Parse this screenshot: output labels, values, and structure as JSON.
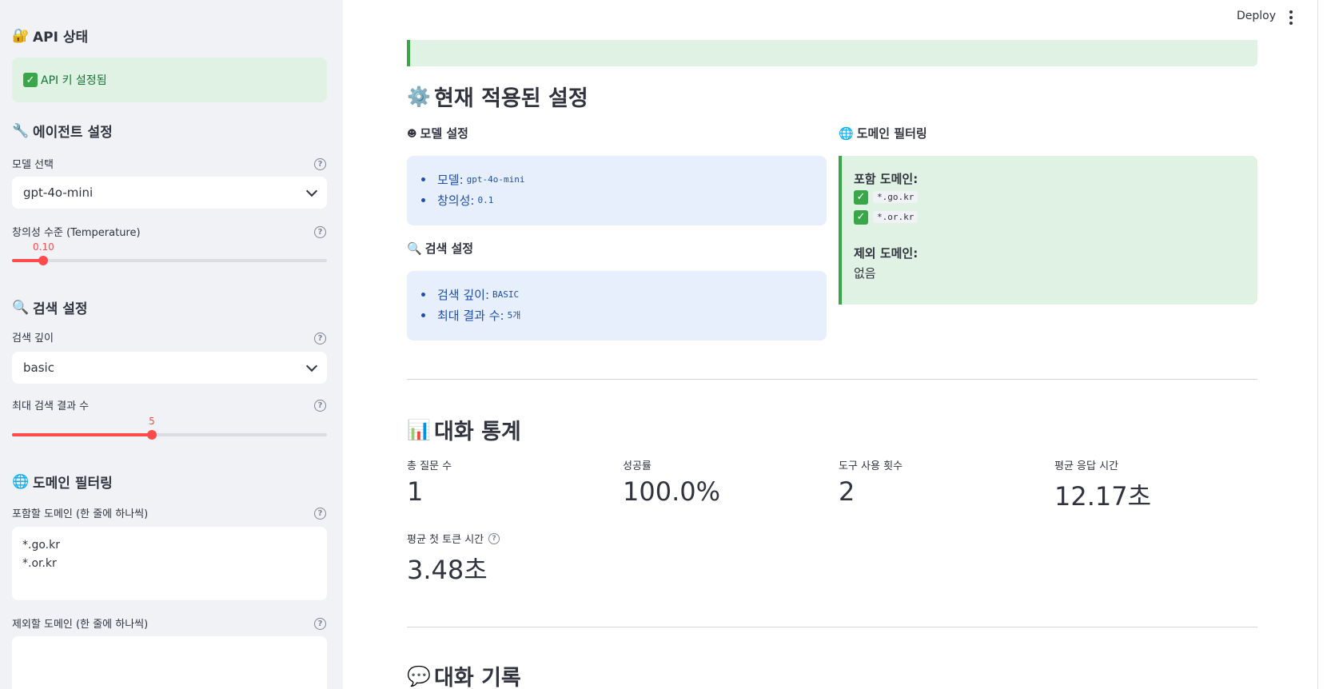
{
  "sidebar": {
    "api_status_title": "API 상태",
    "api_status_message": "API 키 설정됨",
    "agent_settings_title": "에이전트 설정",
    "model_label": "모델 선택",
    "model_value": "gpt-4o-mini",
    "temperature_label": "창의성 수준 (Temperature)",
    "temperature_value": "0.10",
    "temperature_fraction": 0.1,
    "search_settings_title": "검색 설정",
    "search_depth_label": "검색 깊이",
    "search_depth_value": "basic",
    "max_results_label": "최대 검색 결과 수",
    "max_results_value": "5",
    "max_results_fraction": 0.444,
    "domain_filter_title": "도메인 필터링",
    "include_domains_label": "포함할 도메인 (한 줄에 하나씩)",
    "include_domains_lines": [
      "*.go.kr",
      "*.or.kr"
    ],
    "exclude_domains_label": "제외할 도메인 (한 줄에 하나씩)",
    "exclude_domains_value": ""
  },
  "header": {
    "deploy_label": "Deploy"
  },
  "main": {
    "current_settings_title": "현재 적용된 설정",
    "model_settings_title": "모델 설정",
    "model_item_label": "모델:",
    "model_item_value": "gpt-4o-mini",
    "creativity_item_label": "창의성:",
    "creativity_item_value": "0.1",
    "search_settings_title": "검색 설정",
    "depth_item_label": "검색 깊이:",
    "depth_item_value": "BASIC",
    "max_item_label": "최대 결과 수:",
    "max_item_value": "5개",
    "domain_filter_title": "도메인 필터링",
    "include_label": "포함 도메인:",
    "include_domains": [
      "*.go.kr",
      "*.or.kr"
    ],
    "exclude_label": "제외 도메인:",
    "exclude_value": "없음",
    "stats_title": "대화 통계",
    "metrics": [
      {
        "label": "총 질문 수",
        "value": "1"
      },
      {
        "label": "성공률",
        "value": "100.0%"
      },
      {
        "label": "도구 사용 횟수",
        "value": "2"
      },
      {
        "label": "평균 응답 시간",
        "value": "12.17초"
      }
    ],
    "first_token_label": "평균 첫 토큰 시간",
    "first_token_value": "3.48초",
    "history_title": "대화 기록"
  },
  "icons": {
    "lock": "lock-icon",
    "wrench": "wrench-icon",
    "magnifier": "search-icon",
    "globe": "globe-icon",
    "gear": "gear-icon",
    "chart": "chart-icon",
    "speech": "speech-bubble-icon",
    "robot": "robot-icon"
  },
  "colors": {
    "accent": "#ff4b4b",
    "success_bg": "#dff2e3",
    "success_text": "#177233",
    "info_bg": "#e8effc",
    "info_text": "#1e4eaa"
  }
}
